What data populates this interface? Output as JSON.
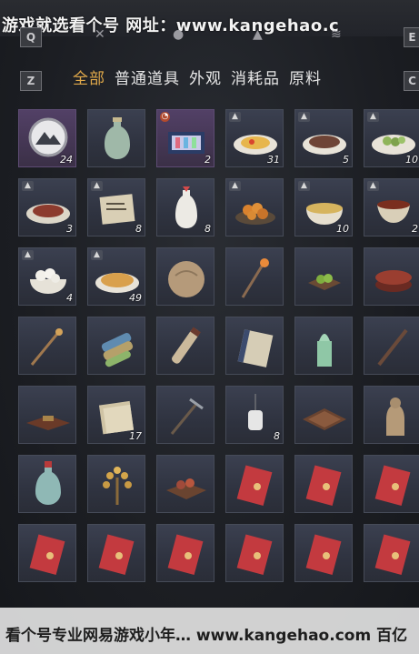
{
  "watermark_top": "游戏就选看个号  网址：www.kangehao.c",
  "watermark_bottom": "看个号专业网易游戏小年… www.kangehao.com 百亿",
  "keys": {
    "q": "Q",
    "e": "E",
    "z": "Z",
    "c": "C"
  },
  "tabs": [
    {
      "label": "全部",
      "active": true
    },
    {
      "label": "普通道具",
      "active": false
    },
    {
      "label": "外观",
      "active": false
    },
    {
      "label": "消耗品",
      "active": false
    },
    {
      "label": "原料",
      "active": false
    }
  ],
  "items": [
    {
      "name": "mountain-token",
      "qty": "24",
      "rare": true
    },
    {
      "name": "celadon-wine-jar",
      "qty": "",
      "rare": false
    },
    {
      "name": "gift-box",
      "qty": "2",
      "rare": true,
      "clock": true
    },
    {
      "name": "egg-dish",
      "qty": "31",
      "badge": true
    },
    {
      "name": "meat-platter",
      "qty": "5",
      "badge": true
    },
    {
      "name": "cucumber-dish",
      "qty": "10",
      "badge": true
    },
    {
      "name": "grilled-meat",
      "qty": "3",
      "badge": true
    },
    {
      "name": "paper-note",
      "qty": "8",
      "badge": true
    },
    {
      "name": "white-vase",
      "qty": "8"
    },
    {
      "name": "fried-balls",
      "qty": "",
      "badge": true
    },
    {
      "name": "noodle-bowl",
      "qty": "10",
      "badge": true
    },
    {
      "name": "tea-bowl",
      "qty": "2",
      "badge": true
    },
    {
      "name": "rice-balls",
      "qty": "4",
      "badge": true
    },
    {
      "name": "fried-rice",
      "qty": "49",
      "badge": true
    },
    {
      "name": "stone-ball",
      "qty": ""
    },
    {
      "name": "lantern-staff",
      "qty": ""
    },
    {
      "name": "green-fruit-plate",
      "qty": ""
    },
    {
      "name": "lacquer-box",
      "qty": ""
    },
    {
      "name": "hairpin",
      "qty": ""
    },
    {
      "name": "cloth-rolls",
      "qty": ""
    },
    {
      "name": "scroll",
      "qty": ""
    },
    {
      "name": "book",
      "qty": ""
    },
    {
      "name": "jade-seal",
      "qty": ""
    },
    {
      "name": "flute",
      "qty": ""
    },
    {
      "name": "incense-tray",
      "qty": ""
    },
    {
      "name": "paper-bundle",
      "qty": "17"
    },
    {
      "name": "pickaxe",
      "qty": ""
    },
    {
      "name": "hanging-lantern",
      "qty": "8"
    },
    {
      "name": "wooden-tray",
      "qty": ""
    },
    {
      "name": "stone-statue",
      "qty": ""
    },
    {
      "name": "red-vase",
      "qty": ""
    },
    {
      "name": "gold-tree",
      "qty": ""
    },
    {
      "name": "fruit-tray",
      "qty": ""
    },
    {
      "name": "red-envelope",
      "qty": ""
    },
    {
      "name": "red-envelope",
      "qty": ""
    },
    {
      "name": "red-envelope",
      "qty": ""
    },
    {
      "name": "red-envelope",
      "qty": ""
    },
    {
      "name": "red-envelope",
      "qty": ""
    },
    {
      "name": "red-envelope",
      "qty": ""
    },
    {
      "name": "red-envelope",
      "qty": ""
    },
    {
      "name": "red-envelope",
      "qty": ""
    },
    {
      "name": "red-envelope",
      "qty": ""
    }
  ]
}
